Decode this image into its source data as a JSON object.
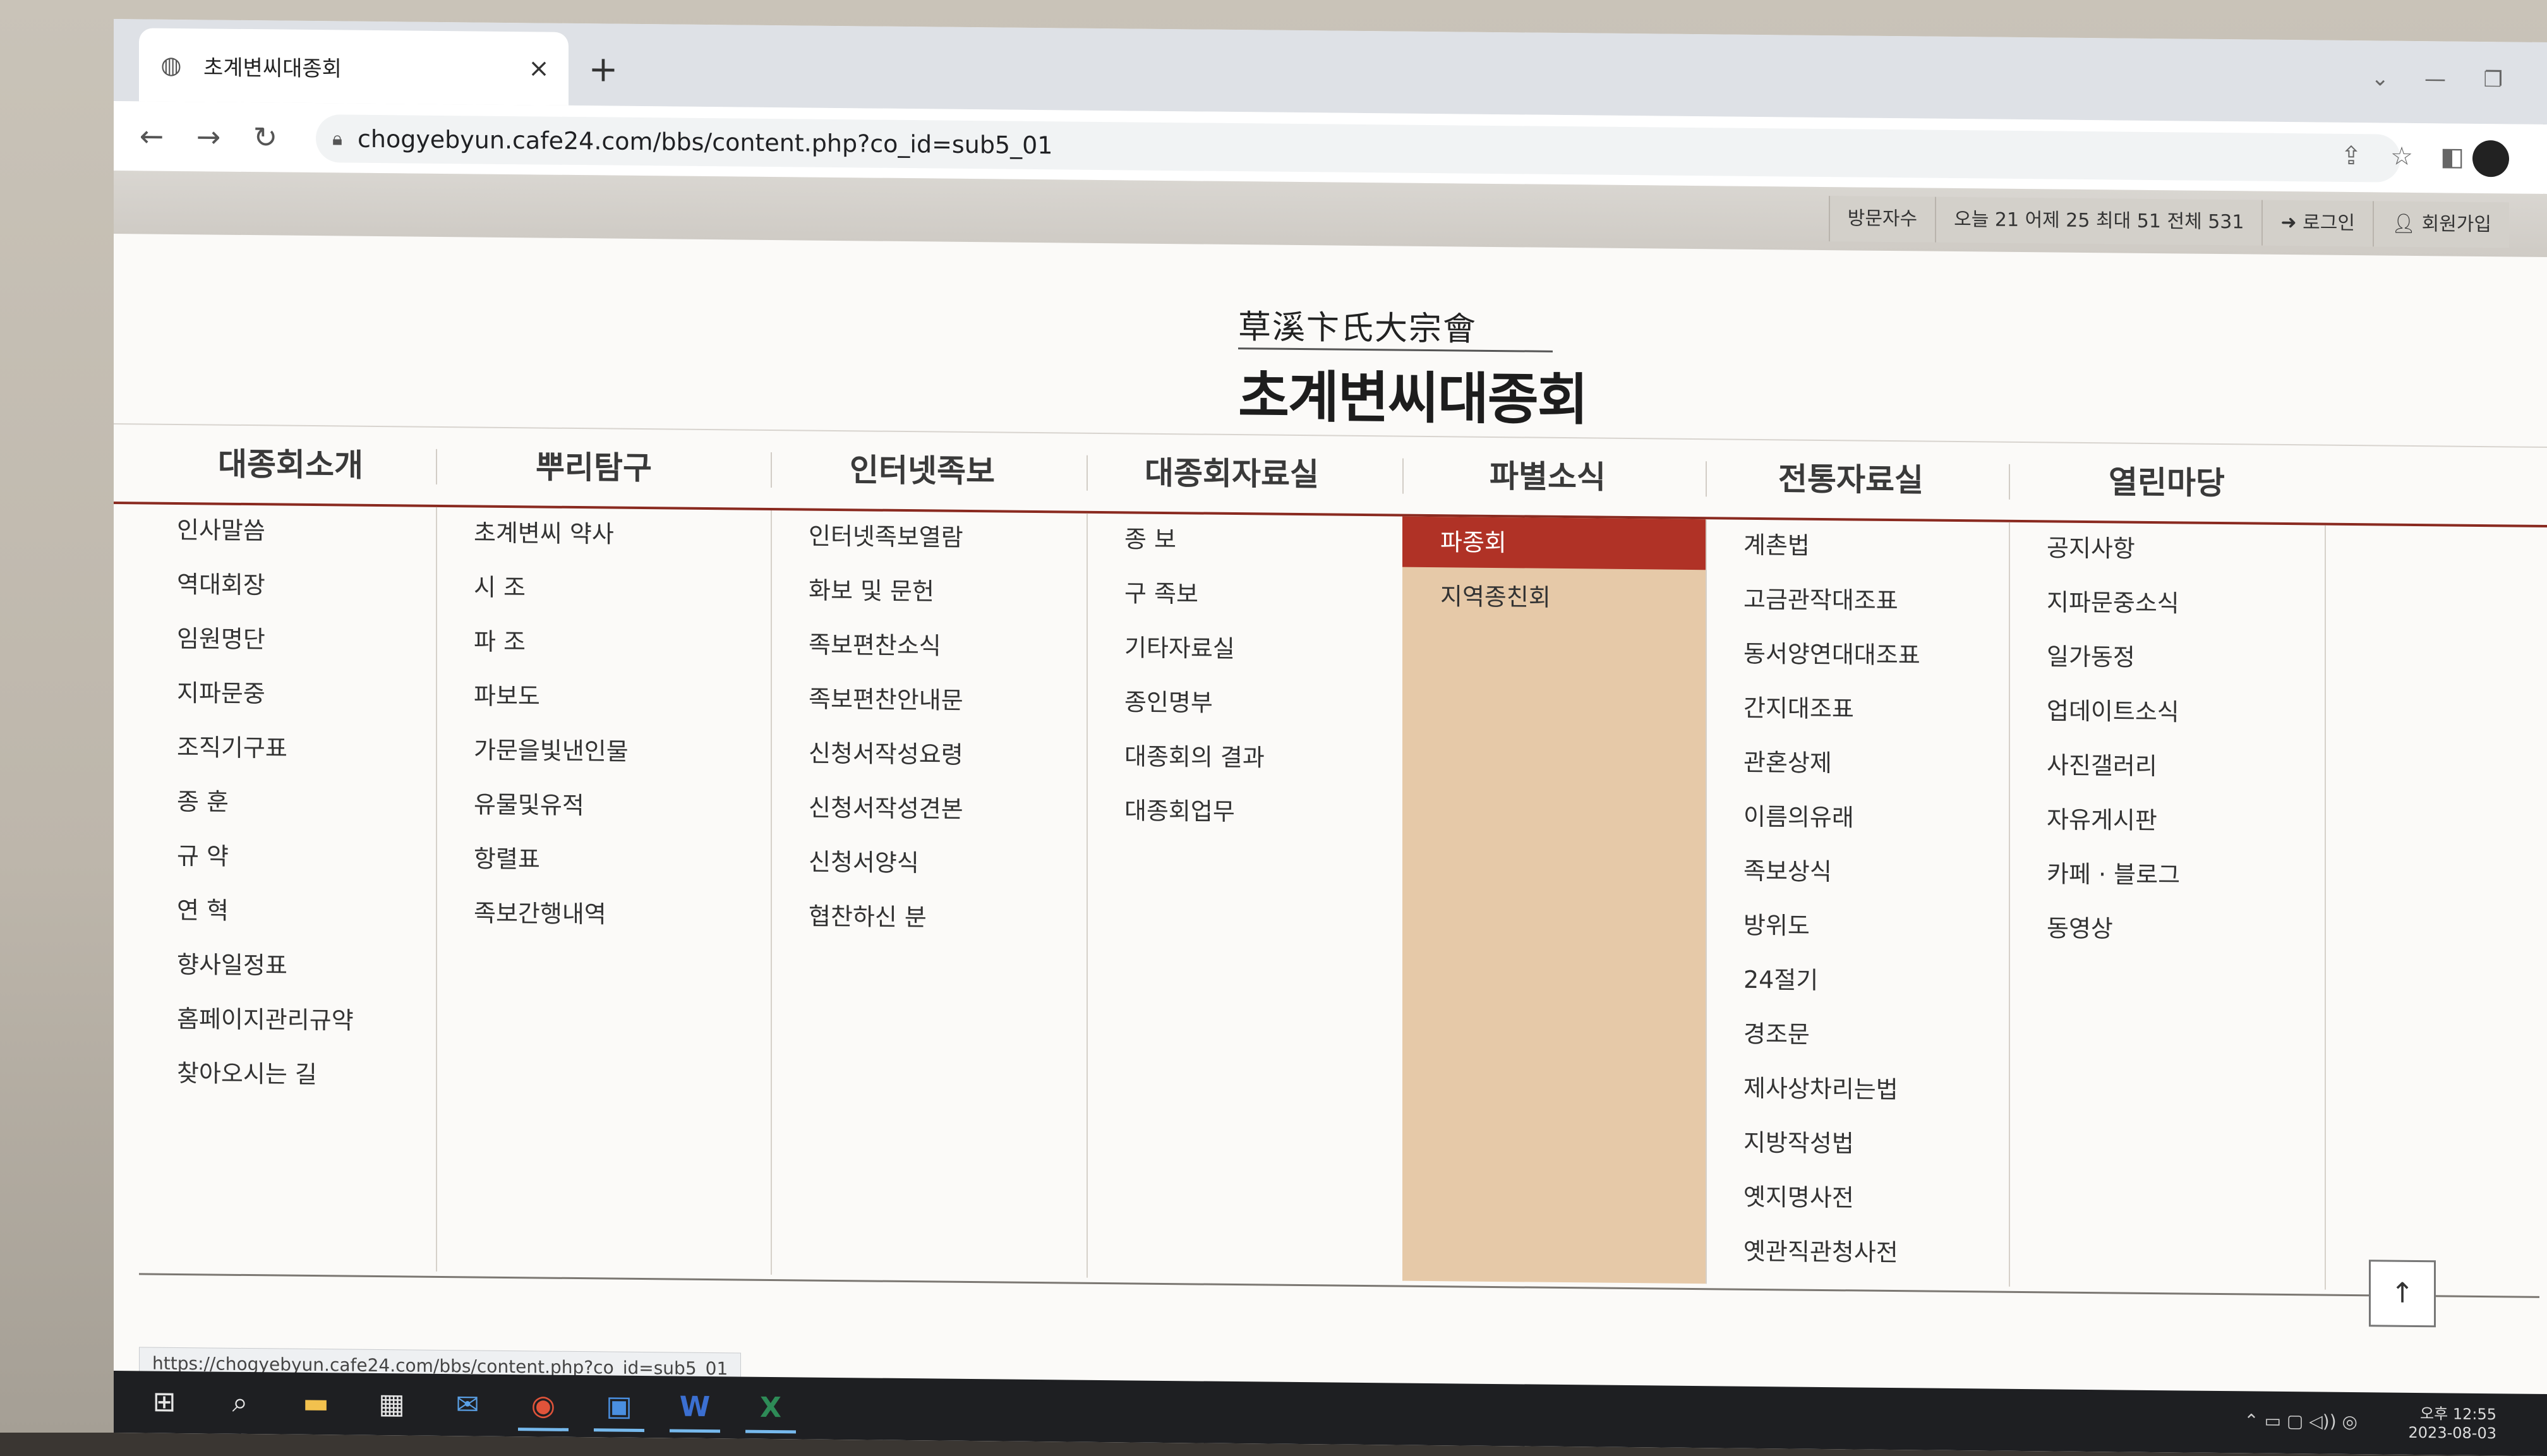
{
  "browser": {
    "tab_title": "초계변씨대종회",
    "tab_close": "×",
    "new_tab": "+",
    "url": "chogyebyun.cafe24.com/bbs/content.php?co_id=sub5_01",
    "icons": [
      "back-icon",
      "forward-icon",
      "reload-icon",
      "lock-icon",
      "share-icon",
      "star-icon",
      "sidepanel-icon",
      "profile-avatar"
    ]
  },
  "header": {
    "visitors_label": "방문자수",
    "visitors_stats": "오늘 21 어제 25 최대 51 전체 531",
    "login_label": "로그인",
    "join_label": "회원가입"
  },
  "logo": {
    "hanja": "草溪卞氏大宗會",
    "hangul": "초계변씨대종회"
  },
  "nav": {
    "menus": [
      {
        "label": "대종회소개",
        "items": [
          "인사말씀",
          "역대회장",
          "임원명단",
          "지파문중",
          "조직기구표",
          "종  훈",
          "규  약",
          "연  혁",
          "향사일정표",
          "홈페이지관리규약",
          "찾아오시는 길"
        ]
      },
      {
        "label": "뿌리탐구",
        "items": [
          "초계변씨 약사",
          "시  조",
          "파  조",
          "파보도",
          "가문을빛낸인물",
          "유물및유적",
          "항렬표",
          "족보간행내역"
        ]
      },
      {
        "label": "인터넷족보",
        "items": [
          "인터넷족보열람",
          "화보 및 문헌",
          "족보편찬소식",
          "족보편찬안내문",
          "신청서작성요령",
          "신청서작성견본",
          "신청서양식",
          "협찬하신 분"
        ]
      },
      {
        "label": "대종회자료실",
        "items": [
          "종  보",
          "구 족보",
          "기타자료실",
          "종인명부",
          "대종회의 결과",
          "대종회업무"
        ]
      },
      {
        "label": "파별소식",
        "items": [
          "파종회",
          "지역종친회"
        ],
        "selected": "파종회"
      },
      {
        "label": "전통자료실",
        "items": [
          "계촌법",
          "고금관작대조표",
          "동서양연대대조표",
          "간지대조표",
          "관혼상제",
          "이름의유래",
          "족보상식",
          "방위도",
          "24절기",
          "경조문",
          "제사상차리는법",
          "지방작성법",
          "옛지명사전",
          "옛관직관청사전"
        ]
      },
      {
        "label": "열린마당",
        "items": [
          "공지사항",
          "지파문중소식",
          "일가동정",
          "업데이트소식",
          "사진갤러리",
          "자유게시판",
          "카페 · 블로그",
          "동영상"
        ]
      }
    ]
  },
  "to_top": "↑",
  "status_url": "https://chogyebyun.cafe24.com/bbs/content.php?co_id=sub5_01",
  "taskbar": {
    "clock_time": "오후 12:55",
    "clock_date": "2023-08-03",
    "apps": [
      "start-icon",
      "search-icon",
      "file-explorer-icon",
      "store-icon",
      "mail-icon",
      "chrome-icon",
      "outlook-icon",
      "word-icon",
      "excel-icon"
    ]
  }
}
